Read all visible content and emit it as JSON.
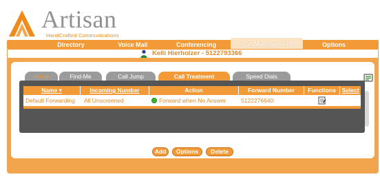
{
  "logo": {
    "name": "Artisan",
    "tagline": "HandCrafted Communications",
    "icon": "artisan-logo-mark"
  },
  "nav": {
    "items": [
      {
        "label": "Directory"
      },
      {
        "label": "Voice Mail"
      },
      {
        "label": "Conferencing"
      },
      {
        "label": "Call Management",
        "active": true
      },
      {
        "label": "Options"
      }
    ]
  },
  "user": {
    "icon": "user-icon",
    "label": "Kelli Hierholzer - 5122793366"
  },
  "tabs": [
    {
      "label": "Home"
    },
    {
      "label": "Find-Me"
    },
    {
      "label": "Call Jump"
    },
    {
      "label": "Call Treatment",
      "active": true
    },
    {
      "label": "Speed Dials"
    }
  ],
  "table": {
    "headers": [
      "Name",
      "Incoming Number",
      "Action",
      "Forward Number",
      "Functions",
      "Select"
    ],
    "rows": [
      {
        "name": "Default Forwarding",
        "incoming": "All Unscreened",
        "action": "Forward when No Answer",
        "forward": "5122276640",
        "function_icon": "edit-icon"
      }
    ]
  },
  "buttons": {
    "add": "Add",
    "options": "Options",
    "delete": "Delete"
  },
  "colors": {
    "accent": "#f29a37",
    "panel": "#555555",
    "text_orange": "#e88a26",
    "status_green": "#3cb52e"
  }
}
